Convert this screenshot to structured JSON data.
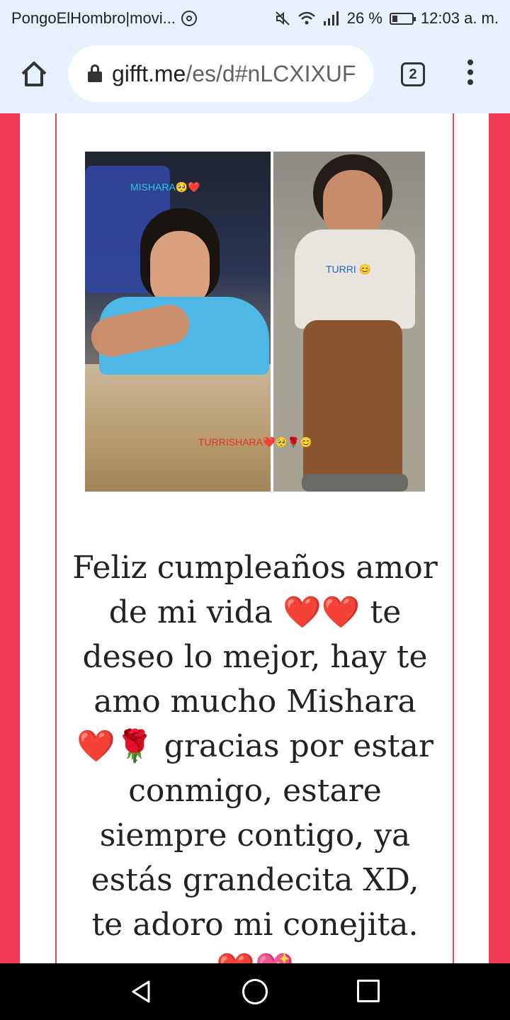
{
  "status_bar": {
    "notification_text": "PongoElHombro|movi...",
    "battery_percent": "26 %",
    "battery_level": 0.26,
    "time": "12:03 a. m.",
    "icons": [
      "whatsapp-icon",
      "mute-icon",
      "wifi-icon",
      "signal-icon",
      "battery-icon"
    ]
  },
  "browser": {
    "url_domain": "gifft.me",
    "url_path": "/es/d#nLCXIXUF",
    "tab_count": "2"
  },
  "photo": {
    "caption_mishara": "MISHARA🥺❤️",
    "caption_turri": "TURRI 😊",
    "caption_both": "TURRISHARA❤️🥺🌹😊"
  },
  "message": {
    "text": "Feliz cumpleaños amor de mi vida ❤️❤️ te deseo lo mejor, hay te amo mucho Mishara ❤️🌹 gracias por estar conmigo, estare siempre contigo, ya estás grandecita XD, te adoro mi conejita. ❤️💖"
  },
  "colors": {
    "page_background": "#f03a56",
    "card_border": "#dd4b5a",
    "browser_bar": "#e8f0fe"
  }
}
